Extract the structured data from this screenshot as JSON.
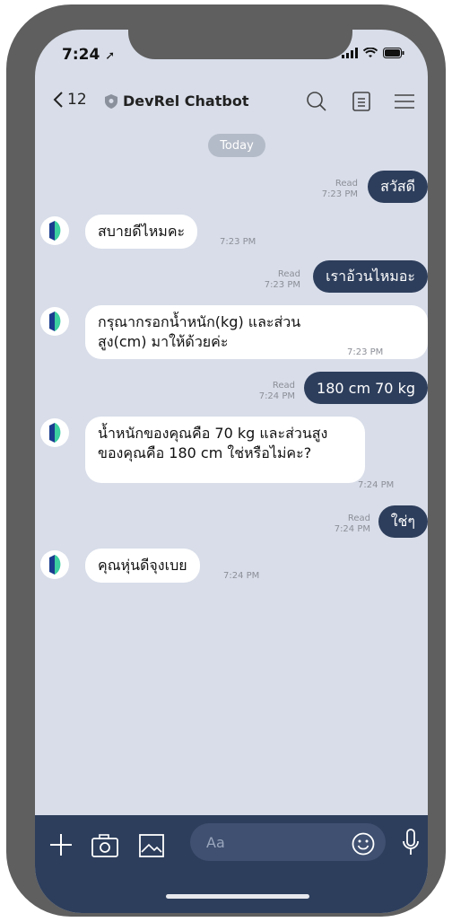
{
  "status": {
    "time": "7:24"
  },
  "header": {
    "back_count": "12",
    "title": "DevRel Chatbot"
  },
  "divider": {
    "today": "Today"
  },
  "messages": [
    {
      "dir": "out",
      "text": "สวัสดี",
      "read": "Read",
      "time": "7:23 PM"
    },
    {
      "dir": "in",
      "text": "สบายดีไหมคะ",
      "time": "7:23 PM"
    },
    {
      "dir": "out",
      "text": "เราอ้วนไหมอะ",
      "read": "Read",
      "time": "7:23 PM"
    },
    {
      "dir": "in",
      "text": "กรุณากรอกน้ำหนัก(kg) และส่วนสูง(cm) มาให้ด้วยค่ะ",
      "time": "7:23 PM"
    },
    {
      "dir": "out",
      "text": "180 cm 70 kg",
      "read": "Read",
      "time": "7:24 PM"
    },
    {
      "dir": "in",
      "text": "น้ำหนักของคุณคือ 70 kg และส่วนสูงของคุณคือ 180 cm ใช่หรือไม่คะ?",
      "time": "7:24 PM"
    },
    {
      "dir": "out",
      "text": "ใช่ๆ",
      "read": "Read",
      "time": "7:24 PM"
    },
    {
      "dir": "in",
      "text": "คุณหุ่นดีจุงเบย",
      "time": "7:24 PM"
    }
  ],
  "composer": {
    "placeholder": "Aa"
  },
  "colors": {
    "outgoing_bubble": "#2d3e5c",
    "incoming_bubble": "#ffffff",
    "background": "#d8dde9"
  }
}
